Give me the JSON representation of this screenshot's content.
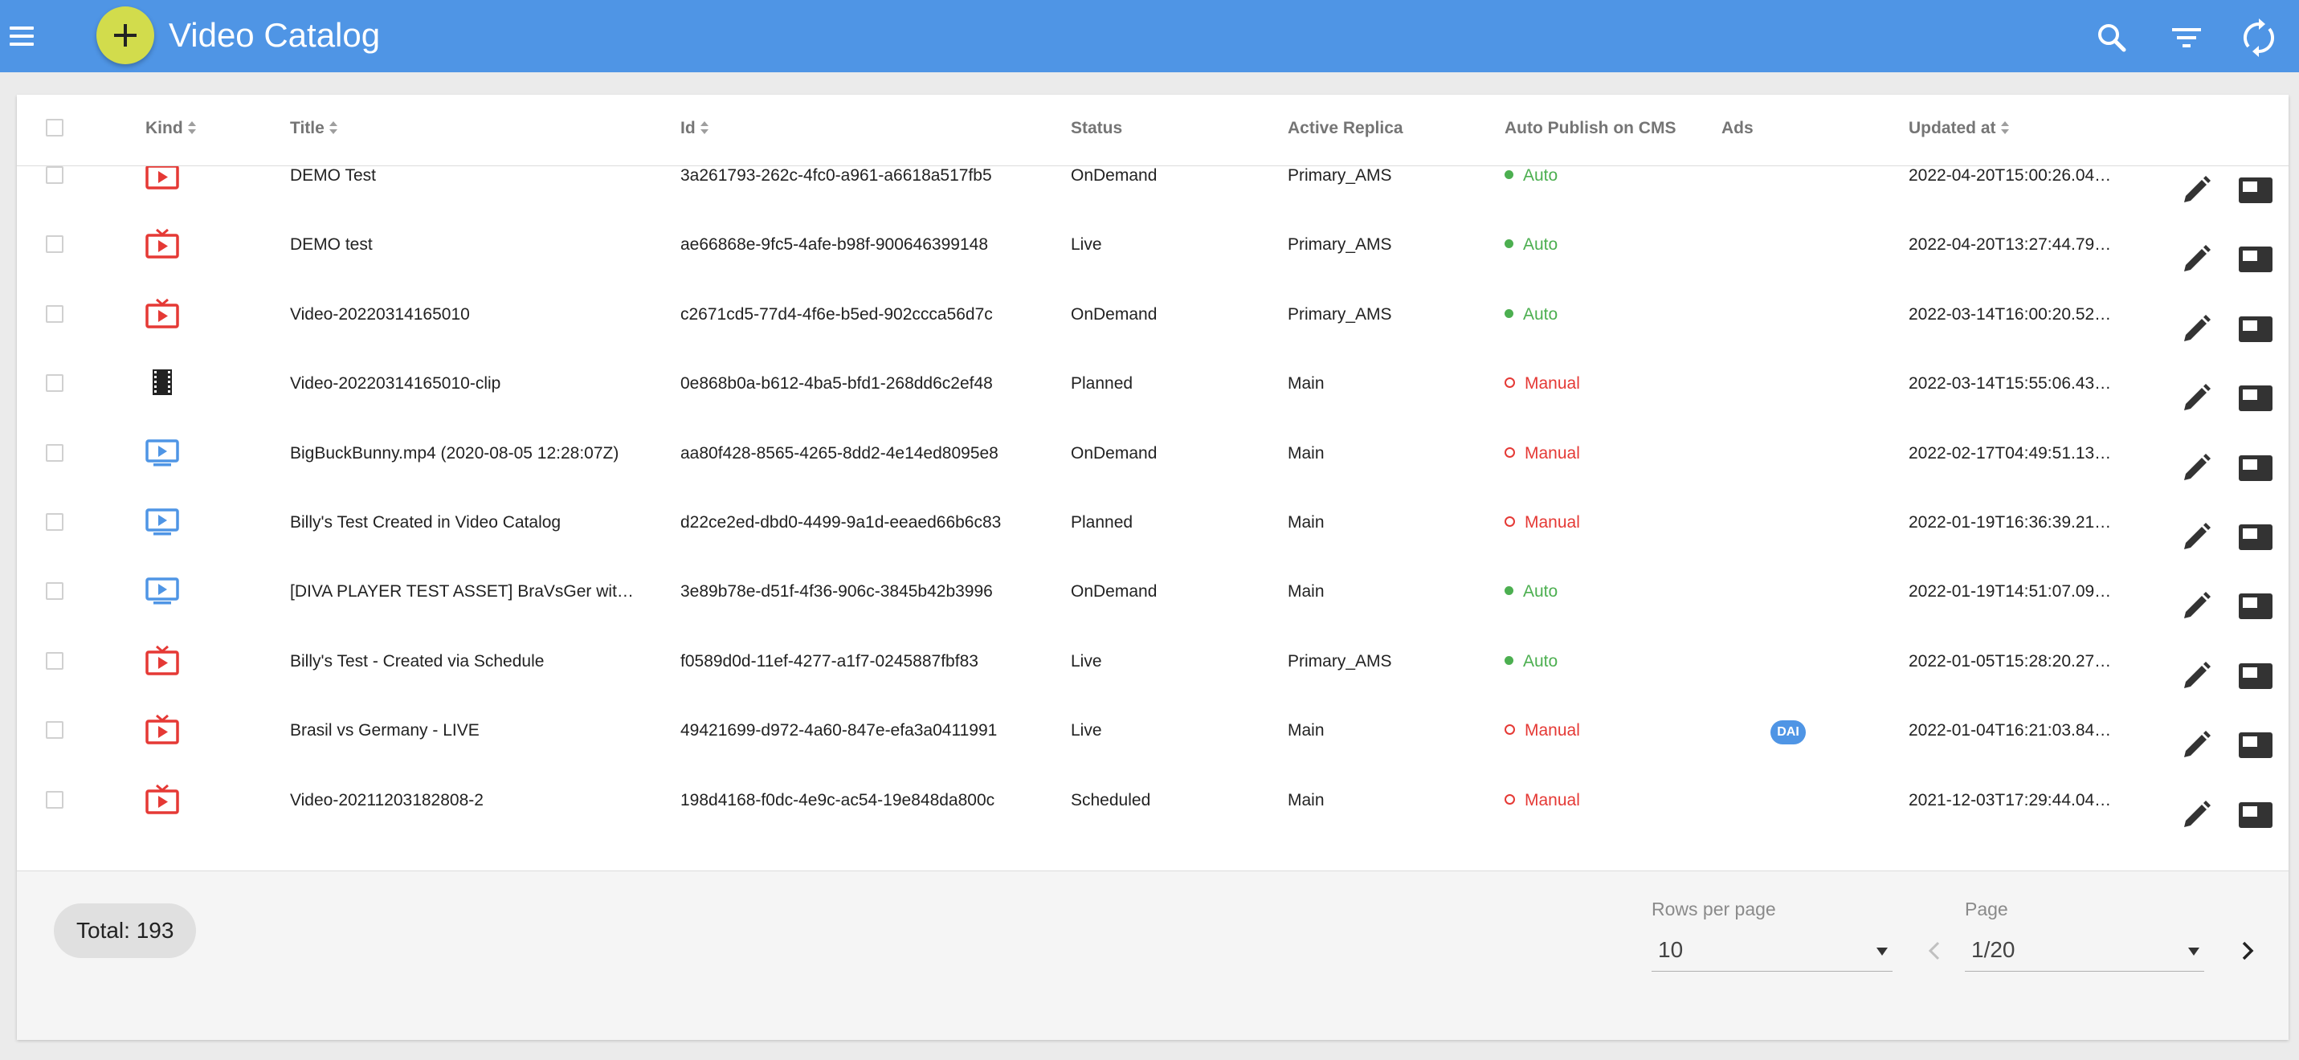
{
  "app": {
    "title": "Video Catalog"
  },
  "toolbar": {
    "menu_icon": "menu-icon",
    "add_icon": "plus-icon",
    "search_icon": "search-icon",
    "filter_icon": "filter-icon",
    "sync_icon": "sync-icon"
  },
  "table": {
    "columns": {
      "kind": "Kind",
      "title": "Title",
      "id": "Id",
      "status": "Status",
      "replica": "Active Replica",
      "publish": "Auto Publish on CMS",
      "ads": "Ads",
      "updated": "Updated at"
    },
    "rows": [
      {
        "kind": "live-tv-icon",
        "title": "DEMO Test",
        "id": "3a261793-262c-4fc0-a961-a6618a517fb5",
        "status": "OnDemand",
        "replica": "Primary_AMS",
        "publish": "Auto",
        "ads": "",
        "updated": "2022-04-20T15:00:26.04…"
      },
      {
        "kind": "live-tv-icon",
        "title": "DEMO test",
        "id": "ae66868e-9fc5-4afe-b98f-900646399148",
        "status": "Live",
        "replica": "Primary_AMS",
        "publish": "Auto",
        "ads": "",
        "updated": "2022-04-20T13:27:44.79…"
      },
      {
        "kind": "live-tv-icon",
        "title": "Video-20220314165010",
        "id": "c2671cd5-77d4-4f6e-b5ed-902ccca56d7c",
        "status": "OnDemand",
        "replica": "Primary_AMS",
        "publish": "Auto",
        "ads": "",
        "updated": "2022-03-14T16:00:20.52…"
      },
      {
        "kind": "movie-clip-icon",
        "title": "Video-20220314165010-clip",
        "id": "0e868b0a-b612-4ba5-bfd1-268dd6c2ef48",
        "status": "Planned",
        "replica": "Main",
        "publish": "Manual",
        "ads": "",
        "updated": "2022-03-14T15:55:06.43…"
      },
      {
        "kind": "ondemand-video-icon",
        "title": "BigBuckBunny.mp4 (2020-08-05 12:28:07Z)",
        "id": "aa80f428-8565-4265-8dd2-4e14ed8095e8",
        "status": "OnDemand",
        "replica": "Main",
        "publish": "Manual",
        "ads": "",
        "updated": "2022-02-17T04:49:51.13…"
      },
      {
        "kind": "ondemand-video-icon",
        "title": "Billy's Test Created in Video Catalog",
        "id": "d22ce2ed-dbd0-4499-9a1d-eeaed66b6c83",
        "status": "Planned",
        "replica": "Main",
        "publish": "Manual",
        "ads": "",
        "updated": "2022-01-19T16:36:39.21…"
      },
      {
        "kind": "ondemand-video-icon",
        "title": "[DIVA PLAYER TEST ASSET] BraVsGer wit…",
        "id": "3e89b78e-d51f-4f36-906c-3845b42b3996",
        "status": "OnDemand",
        "replica": "Main",
        "publish": "Auto",
        "ads": "",
        "updated": "2022-01-19T14:51:07.09…"
      },
      {
        "kind": "live-tv-icon",
        "title": "Billy's Test - Created via Schedule",
        "id": "f0589d0d-11ef-4277-a1f7-0245887fbf83",
        "status": "Live",
        "replica": "Primary_AMS",
        "publish": "Auto",
        "ads": "",
        "updated": "2022-01-05T15:28:20.27…"
      },
      {
        "kind": "live-tv-icon",
        "title": "Brasil vs Germany - LIVE",
        "id": "49421699-d972-4a60-847e-efa3a0411991",
        "status": "Live",
        "replica": "Main",
        "publish": "Manual",
        "ads": "DAI",
        "updated": "2022-01-04T16:21:03.84…"
      },
      {
        "kind": "live-tv-icon",
        "title": "Video-20211203182808-2",
        "id": "198d4168-f0dc-4e9c-ac54-19e848da800c",
        "status": "Scheduled",
        "replica": "Main",
        "publish": "Manual",
        "ads": "",
        "updated": "2021-12-03T17:29:44.04…"
      }
    ]
  },
  "footer": {
    "total": "Total: 193",
    "rows_per_page_label": "Rows per page",
    "rows_per_page_value": "10",
    "page_label": "Page",
    "page_value": "1/20",
    "prev_icon": "chevron-left-icon",
    "next_icon": "chevron-right-icon"
  },
  "colors": {
    "appbar": "#4f95e5",
    "add_button": "#d2dc4c",
    "auto": "#4caf50",
    "manual": "#e53935",
    "live_icon": "#e53935",
    "ondemand_icon": "#4f95e5"
  }
}
